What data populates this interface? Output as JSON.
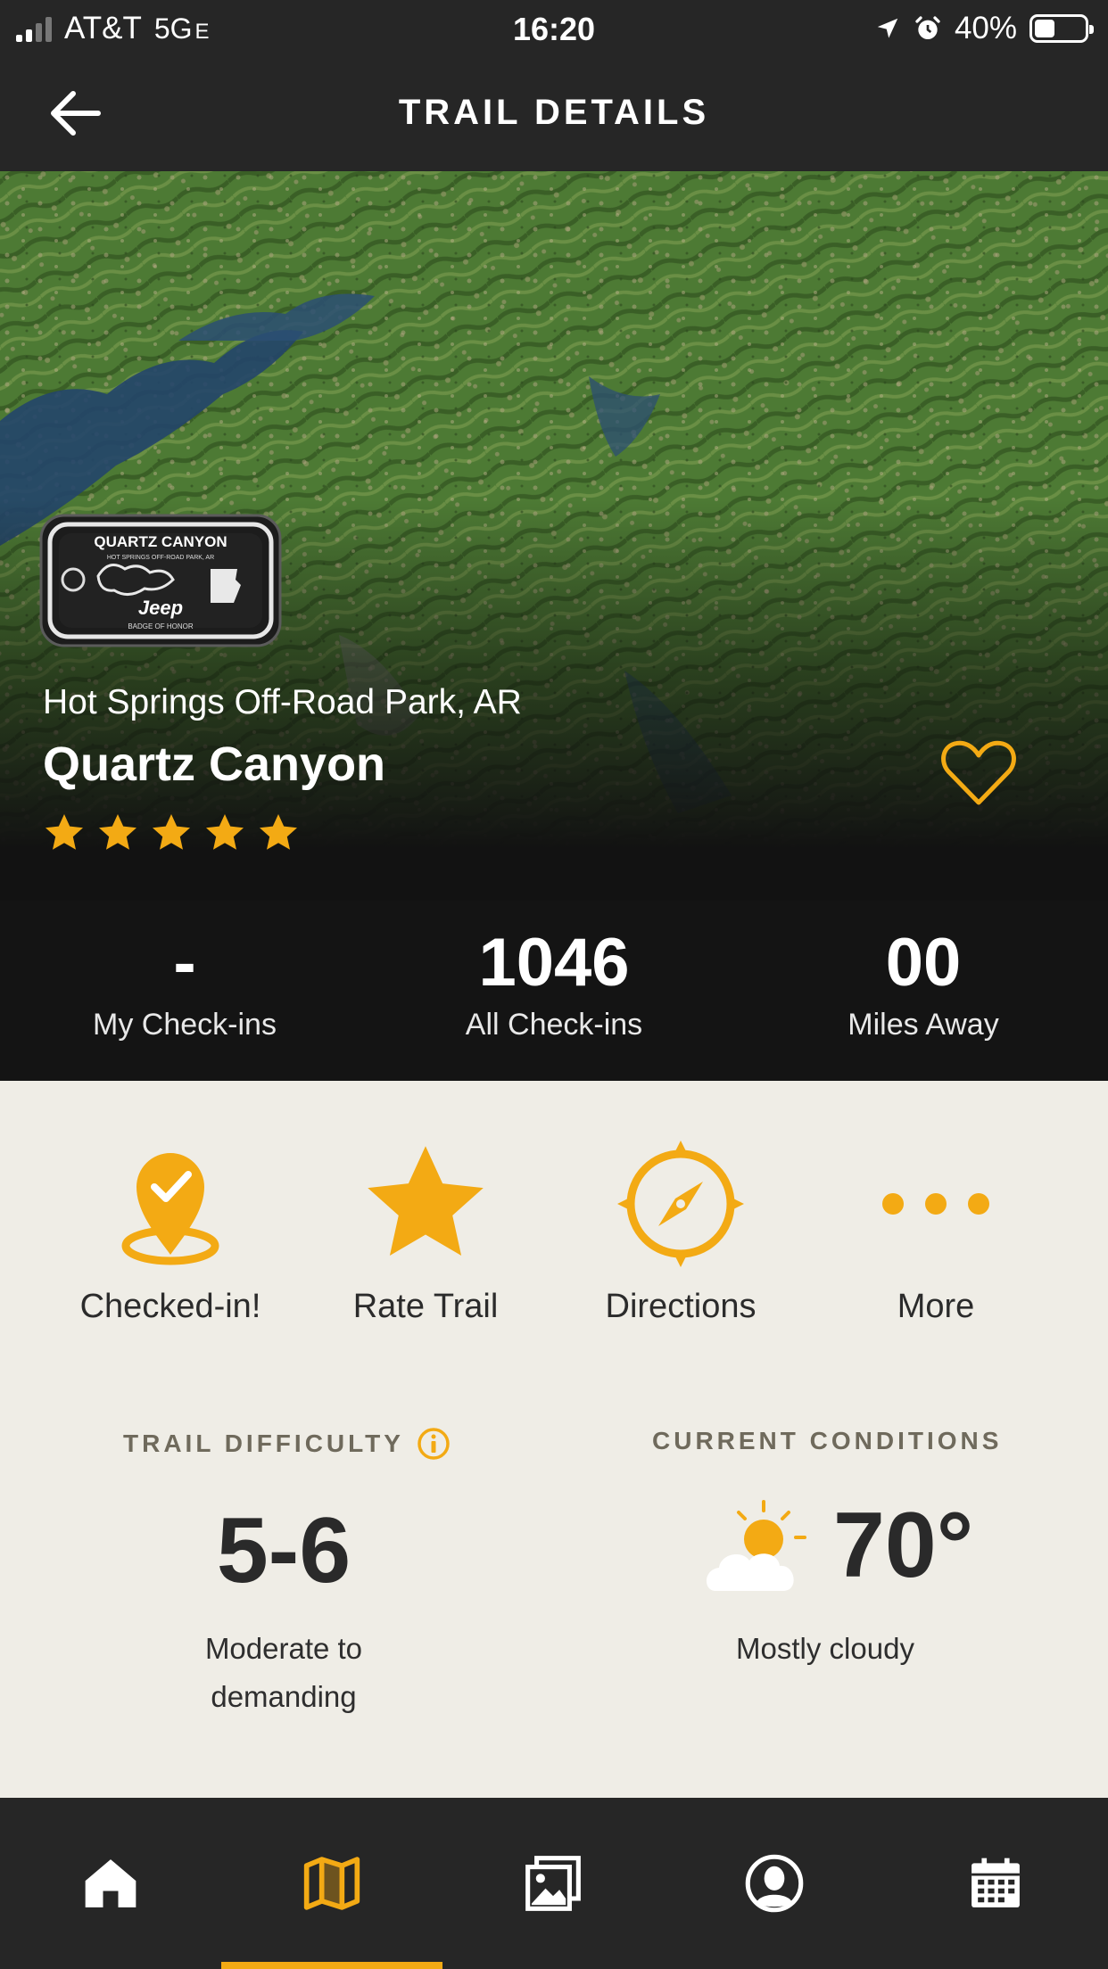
{
  "status_bar": {
    "carrier": "AT&T",
    "network": "5G",
    "network_suffix": "E",
    "time": "16:20",
    "battery_percent": "40%",
    "battery_level": 0.4
  },
  "header": {
    "title": "TRAIL DETAILS",
    "back_icon": "arrow-left-icon"
  },
  "trail": {
    "badge": {
      "title": "QUARTZ CANYON",
      "subtitle": "HOT SPRINGS OFF-ROAD PARK, AR",
      "brand": "Jeep",
      "caption": "BADGE OF HONOR"
    },
    "park_name": "Hot Springs Off-Road Park, AR",
    "name": "Quartz Canyon",
    "rating": 5,
    "rating_max": 5
  },
  "stats": [
    {
      "value": "-",
      "label": "My Check-ins"
    },
    {
      "value": "1046",
      "label": "All Check-ins"
    },
    {
      "value": "00",
      "label": "Miles Away"
    }
  ],
  "actions": [
    {
      "label": "Checked-in!",
      "icon": "location-check-icon"
    },
    {
      "label": "Rate Trail",
      "icon": "star-icon"
    },
    {
      "label": "Directions",
      "icon": "compass-icon"
    },
    {
      "label": "More",
      "icon": "more-dots-icon"
    }
  ],
  "difficulty": {
    "title": "TRAIL DIFFICULTY",
    "value": "5-6",
    "description_line1": "Moderate to",
    "description_line2": "demanding"
  },
  "conditions": {
    "title": "CURRENT CONDITIONS",
    "temperature": "70°",
    "description": "Mostly cloudy",
    "icon": "partly-cloudy-icon"
  },
  "bottom_nav": {
    "items": [
      {
        "icon": "home-icon"
      },
      {
        "icon": "map-icon",
        "active": true
      },
      {
        "icon": "gallery-icon"
      },
      {
        "icon": "profile-icon"
      },
      {
        "icon": "calendar-icon"
      }
    ]
  },
  "colors": {
    "accent": "#f3aa14",
    "dark": "#262626",
    "panel": "#141414",
    "background": "#efede6"
  }
}
